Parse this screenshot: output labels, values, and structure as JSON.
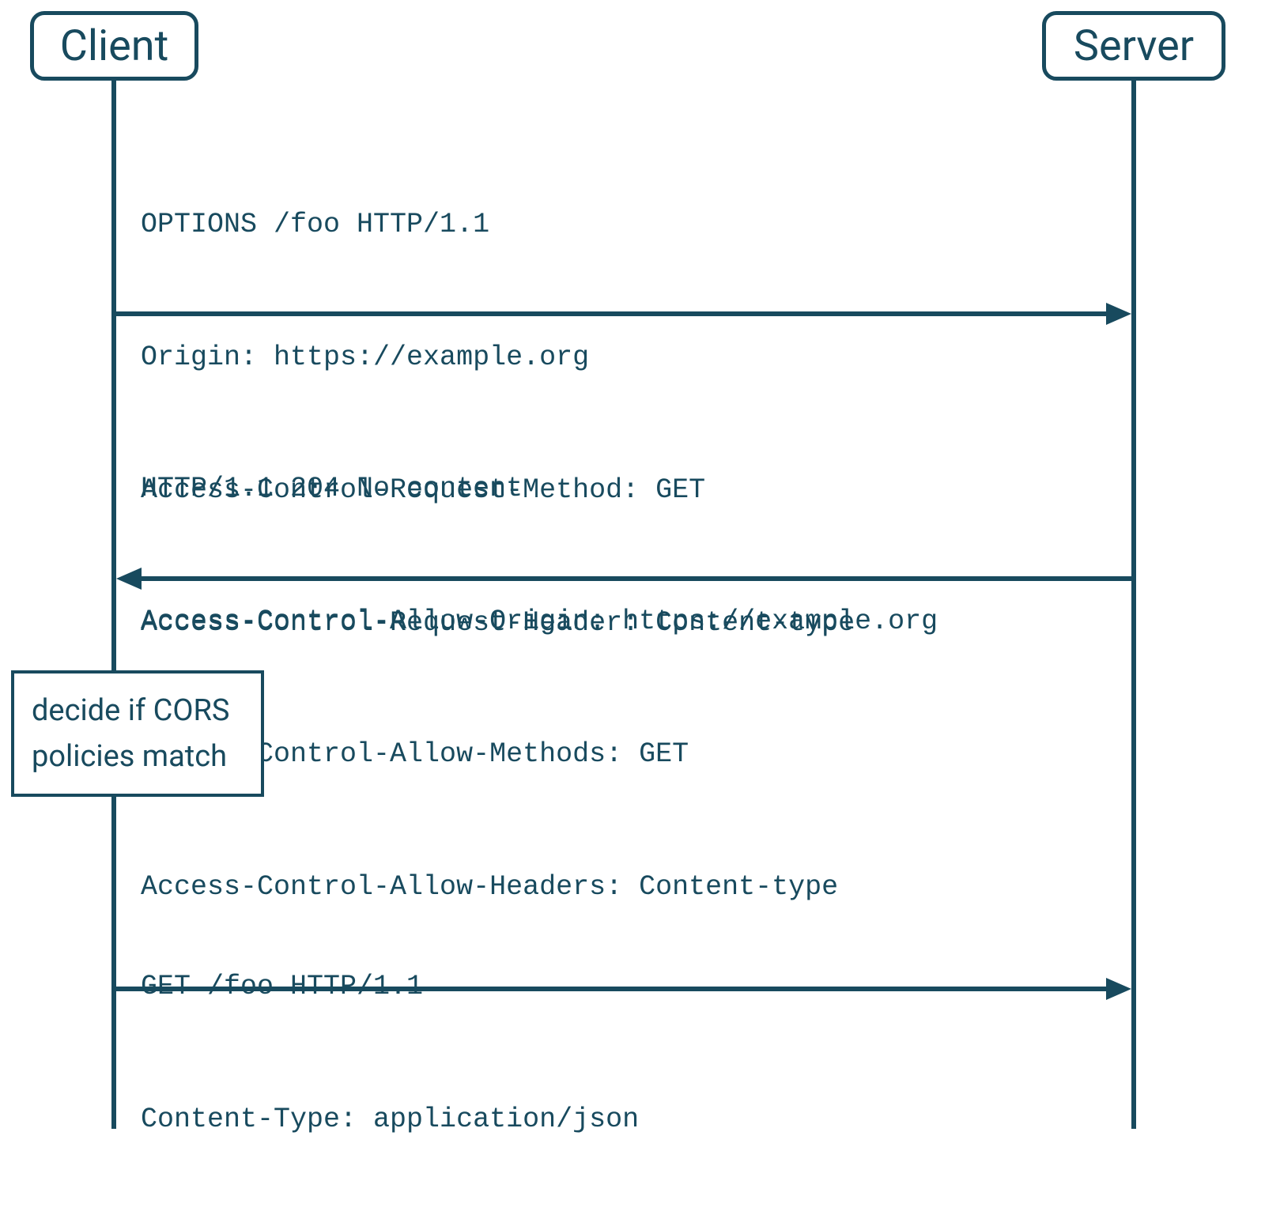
{
  "participants": {
    "client": "Client",
    "server": "Server"
  },
  "messages": {
    "preflight_request": [
      "OPTIONS /foo HTTP/1.1",
      "Origin: https://example.org",
      "Access-Control-Request-Method: GET",
      "Access-Control-Request-Header: Content-type"
    ],
    "preflight_response": [
      "HTTP/1.1 204 No content",
      "Access-Control-Allow-Origin: https://example.org",
      "Access-Control-Allow-Methods: GET",
      "Access-Control-Allow-Headers: Content-type"
    ],
    "actual_request": [
      "GET /foo HTTP/1.1",
      "Content-Type: application/json"
    ]
  },
  "note": {
    "lines": [
      "decide if CORS",
      "policies match"
    ]
  },
  "colors": {
    "primary": "#184a5e"
  }
}
